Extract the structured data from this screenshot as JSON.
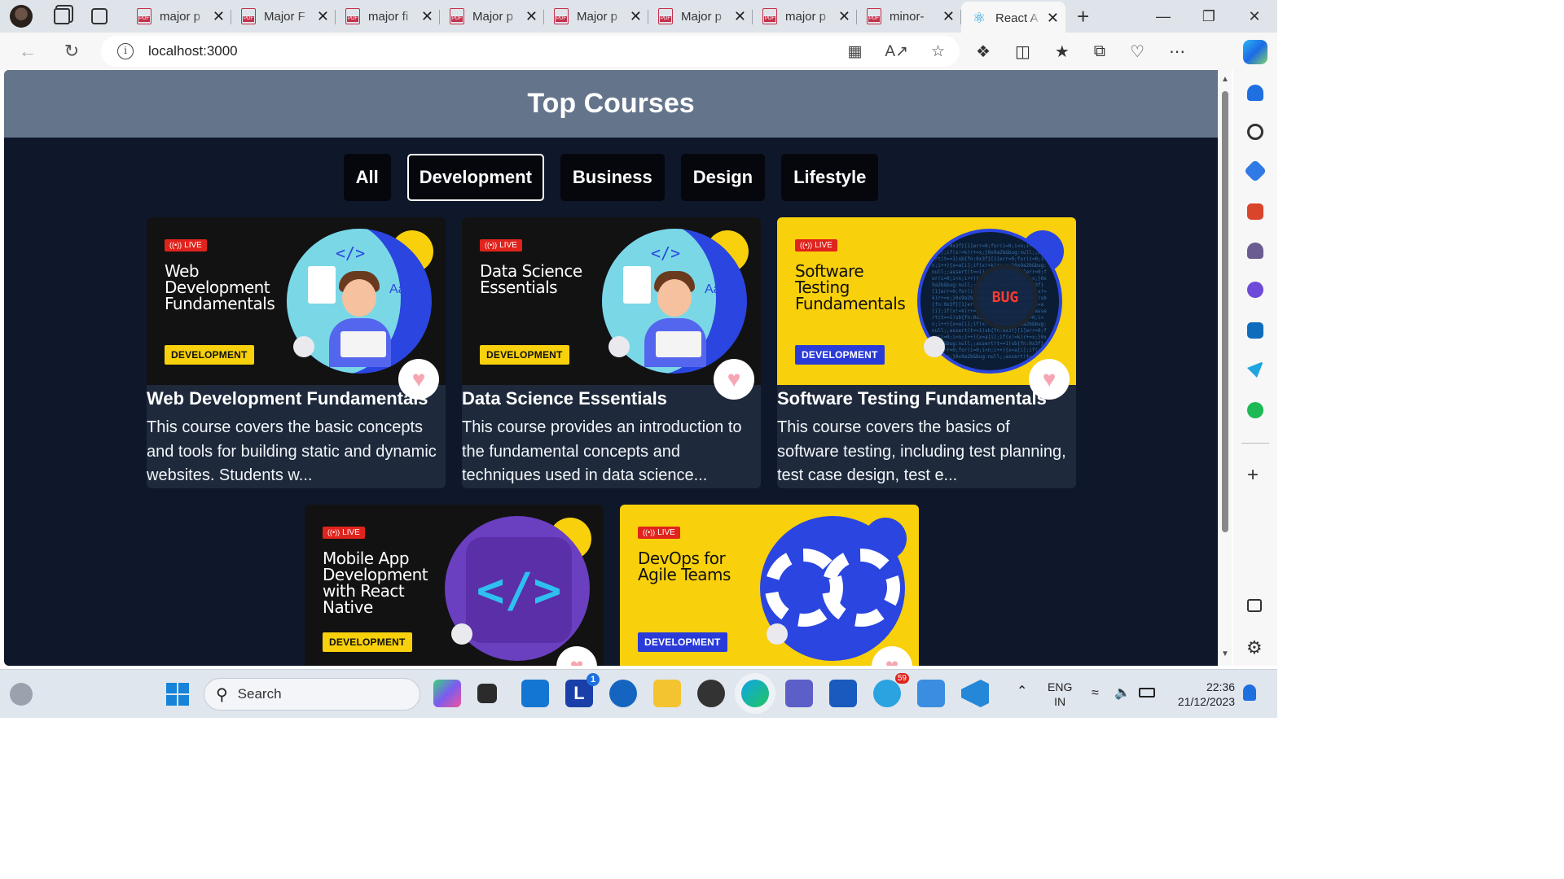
{
  "browser": {
    "tabs": [
      {
        "title": "major p",
        "type": "pdf"
      },
      {
        "title": "Major F",
        "type": "pdf"
      },
      {
        "title": "major fi",
        "type": "pdf"
      },
      {
        "title": "Major p",
        "type": "pdf"
      },
      {
        "title": "Major p",
        "type": "pdf"
      },
      {
        "title": "Major p",
        "type": "pdf"
      },
      {
        "title": "major p",
        "type": "pdf"
      },
      {
        "title": "minor-",
        "type": "pdf"
      },
      {
        "title": "React A",
        "type": "react",
        "active": true
      }
    ],
    "pdf_badge": "PDF",
    "url": "localhost:3000"
  },
  "page": {
    "title": "Top Courses",
    "filters": [
      "All",
      "Development",
      "Business",
      "Design",
      "Lifestyle"
    ],
    "active_filter": "Development",
    "live_label": "LIVE",
    "courses": [
      {
        "thumb_title": "Web Development Fundamentals",
        "category": "DEVELOPMENT",
        "title": "Web Development Fundamentals",
        "description": "This course covers the basic concepts and tools for building static and dynamic websites. Students w...",
        "theme": "dark",
        "art": "person"
      },
      {
        "thumb_title": "Data Science Essentials",
        "category": "DEVELOPMENT",
        "title": "Data Science Essentials",
        "description": "This course provides an introduction to the fundamental concepts and techniques used in data science...",
        "theme": "dark",
        "art": "person"
      },
      {
        "thumb_title": "Software Testing Fundamentals",
        "category": "DEVELOPMENT",
        "title": "Software Testing Fundamentals",
        "description": "This course covers the basics of software testing, including test planning, test case design, test e...",
        "theme": "yellow",
        "art": "bug"
      },
      {
        "thumb_title": "Mobile App Development with React Native",
        "category": "DEVELOPMENT",
        "title": "",
        "description": "",
        "theme": "dark",
        "art": "code"
      },
      {
        "thumb_title": "DevOps for Agile Teams",
        "category": "DEVELOPMENT",
        "title": "",
        "description": "",
        "theme": "yellow",
        "art": "devops"
      }
    ],
    "bug_text": "BUG"
  },
  "taskbar": {
    "search_placeholder": "Search",
    "lang_top": "ENG",
    "lang_bottom": "IN",
    "time": "22:36",
    "date": "21/12/2023",
    "mail_badge": "1",
    "telegram_badge": "59"
  },
  "colors": {
    "page_bg": "#0f172a",
    "header_bg": "#64748b",
    "card_bg": "#1e293b",
    "accent_yellow": "#f8d00b",
    "accent_blue": "#2b45e0",
    "live_red": "#e0231c"
  }
}
